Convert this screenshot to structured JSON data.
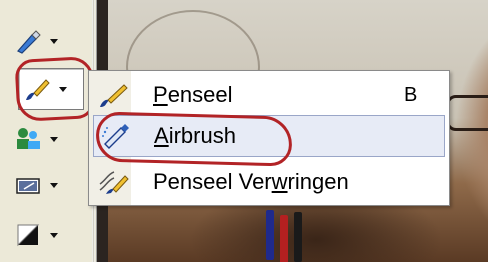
{
  "menu": {
    "items": [
      {
        "pre": "",
        "key": "P",
        "post": "enseel",
        "shortcut": "B",
        "icon": "brush-icon"
      },
      {
        "pre": "",
        "key": "A",
        "post": "irbrush",
        "shortcut": "",
        "icon": "airbrush-icon"
      },
      {
        "pre": "Penseel Ver",
        "key": "w",
        "post": "ringen",
        "shortcut": "",
        "icon": "warp-brush-icon"
      }
    ],
    "highlighted_index": 1
  },
  "toolbar": {
    "tools": [
      "pen-icon",
      "brush-icon",
      "clone-stamp-icon",
      "eraser-icon",
      "fill-icon"
    ],
    "active_index": 1
  },
  "colors": {
    "annotation": "#b22326",
    "menu_hover": "#e7ebf6",
    "toolbar_bg": "#ece9d8"
  }
}
